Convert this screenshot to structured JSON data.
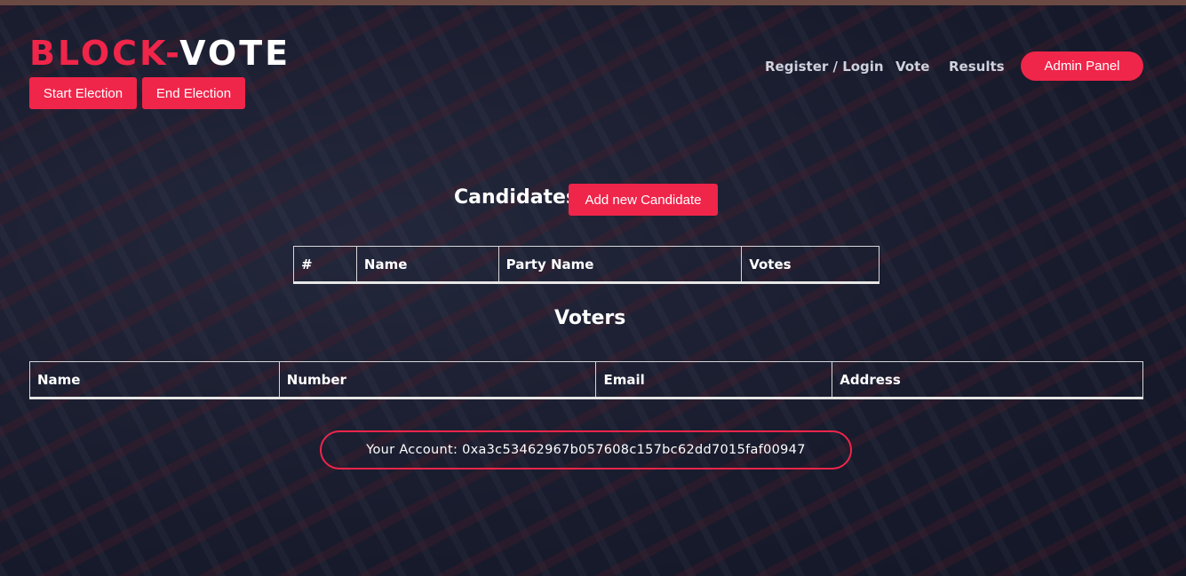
{
  "brand": {
    "part1": "BLOCK-",
    "part2": "VOTE"
  },
  "admin_actions": {
    "start_label": "Start Election",
    "end_label": "End Election"
  },
  "nav": {
    "register_login": "Register / Login",
    "vote": "Vote",
    "results": "Results",
    "admin_panel": "Admin Panel"
  },
  "candidates": {
    "title": "Candidates",
    "add_label": "Add new Candidate",
    "columns": [
      "#",
      "Name",
      "Party Name",
      "Votes"
    ]
  },
  "voters": {
    "title": "Voters",
    "columns": [
      "Name",
      "Number",
      "Email",
      "Address"
    ]
  },
  "account": {
    "text": "Your Account: 0xa3c53462967b057608c157bc62dd7015faf00947"
  },
  "colors": {
    "accent": "#f0254a",
    "text": "#ffffff",
    "nav_text": "#cfd2dc"
  }
}
